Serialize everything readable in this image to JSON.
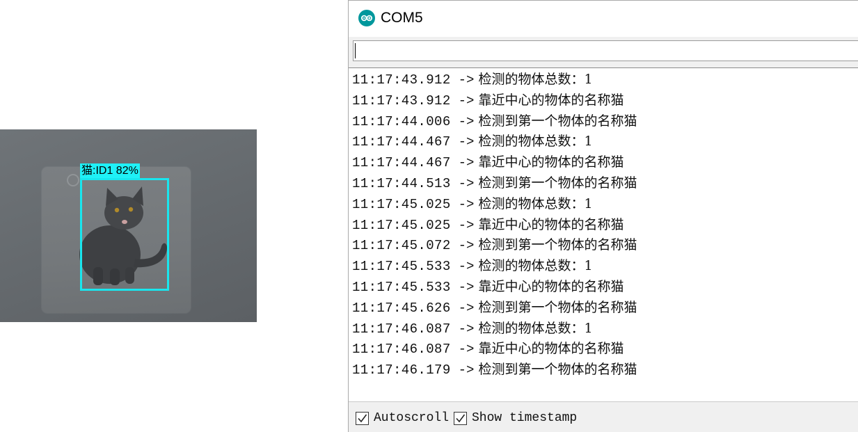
{
  "camera": {
    "detection_label": "猫:ID1 82%"
  },
  "window": {
    "title": "COM5",
    "send_input_value": "",
    "autoscroll_label": "Autoscroll",
    "autoscroll_checked": true,
    "timestamp_label": "Show timestamp",
    "timestamp_checked": true
  },
  "log": {
    "arrow": "->",
    "lines": [
      {
        "ts": "11:17:43.912",
        "msg": "检测的物体总数：1"
      },
      {
        "ts": "11:17:43.912",
        "msg": "靠近中心的物体的名称猫"
      },
      {
        "ts": "11:17:44.006",
        "msg": "检测到第一个物体的名称猫"
      },
      {
        "ts": "11:17:44.467",
        "msg": "检测的物体总数：1"
      },
      {
        "ts": "11:17:44.467",
        "msg": "靠近中心的物体的名称猫"
      },
      {
        "ts": "11:17:44.513",
        "msg": "检测到第一个物体的名称猫"
      },
      {
        "ts": "11:17:45.025",
        "msg": "检测的物体总数：1"
      },
      {
        "ts": "11:17:45.025",
        "msg": "靠近中心的物体的名称猫"
      },
      {
        "ts": "11:17:45.072",
        "msg": "检测到第一个物体的名称猫"
      },
      {
        "ts": "11:17:45.533",
        "msg": "检测的物体总数：1"
      },
      {
        "ts": "11:17:45.533",
        "msg": "靠近中心的物体的名称猫"
      },
      {
        "ts": "11:17:45.626",
        "msg": "检测到第一个物体的名称猫"
      },
      {
        "ts": "11:17:46.087",
        "msg": "检测的物体总数：1"
      },
      {
        "ts": "11:17:46.087",
        "msg": "靠近中心的物体的名称猫"
      },
      {
        "ts": "11:17:46.179",
        "msg": "检测到第一个物体的名称猫"
      }
    ]
  },
  "colors": {
    "detection_box": "#19e6ee",
    "app_logo": "#00979c"
  },
  "icons": {
    "app_logo": "arduino-logo-icon",
    "checkbox_mark": "checkmark-icon"
  }
}
